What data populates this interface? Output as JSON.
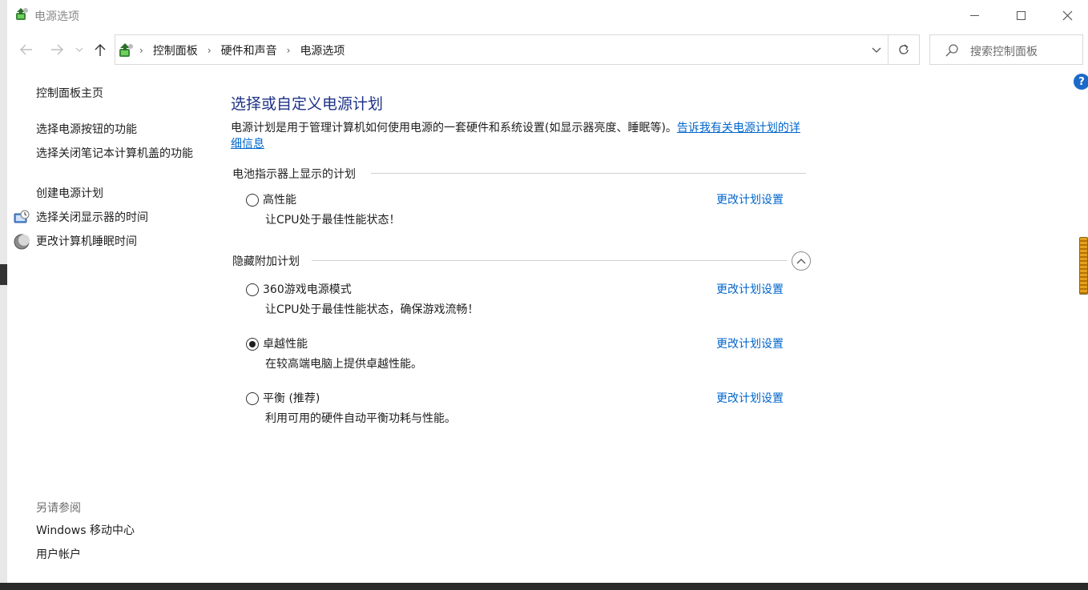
{
  "window": {
    "title": "电源选项"
  },
  "nav": {
    "breadcrumbs": [
      "控制面板",
      "硬件和声音",
      "电源选项"
    ],
    "search_placeholder": "搜索控制面板"
  },
  "sidebar": {
    "items": [
      {
        "label": "控制面板主页"
      },
      {
        "label": "选择电源按钮的功能"
      },
      {
        "label": "选择关闭笔记本计算机盖的功能"
      },
      {
        "label": "创建电源计划"
      },
      {
        "label": "选择关闭显示器的时间",
        "icon": "monitor-clock-icon"
      },
      {
        "label": "更改计算机睡眠时间",
        "icon": "moon-icon"
      }
    ],
    "see_also_label": "另请参阅",
    "see_also": [
      {
        "label": "Windows 移动中心"
      },
      {
        "label": "用户帐户"
      }
    ]
  },
  "main": {
    "title": "选择或自定义电源计划",
    "description": "电源计划是用于管理计算机如何使用电源的一套硬件和系统设置(如显示器亮度、睡眠等)。",
    "description_link": "告诉我有关电源计划的详细信息",
    "battery_group_label": "电池指示器上显示的计划",
    "hidden_group_label": "隐藏附加计划",
    "change_link": "更改计划设置",
    "plans": [
      {
        "name": "高性能",
        "desc": "让CPU处于最佳性能状态！",
        "selected": false
      },
      {
        "name": "360游戏电源模式",
        "desc": "让CPU处于最佳性能状态，确保游戏流畅！",
        "selected": false
      },
      {
        "name": "卓越性能",
        "desc": "在较高端电脑上提供卓越性能。",
        "selected": true
      },
      {
        "name": "平衡 (推荐)",
        "desc": "利用可用的硬件自动平衡功耗与性能。",
        "selected": false
      }
    ]
  },
  "colors": {
    "link": "#0066cc",
    "title": "#1e3287",
    "help": "#1b6ac9"
  }
}
